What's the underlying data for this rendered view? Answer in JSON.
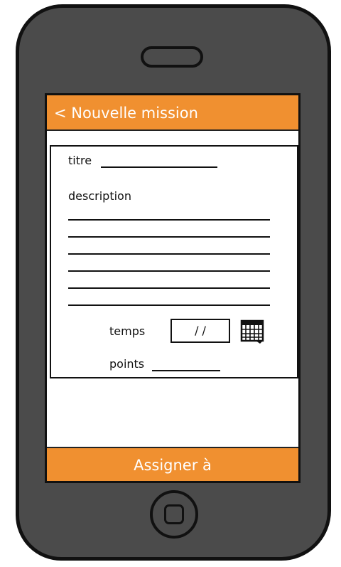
{
  "header": {
    "title": "< Nouvelle mission"
  },
  "form": {
    "title_label": "titre",
    "description_label": "description",
    "time_label": "temps",
    "date_value": "/ /",
    "points_label": "points"
  },
  "footer": {
    "assign_label": "Assigner à"
  },
  "icons": {
    "calendar": "calendar-icon"
  },
  "colors": {
    "accent": "#f09030",
    "phone_body": "#4b4b4b",
    "outline": "#111111"
  }
}
